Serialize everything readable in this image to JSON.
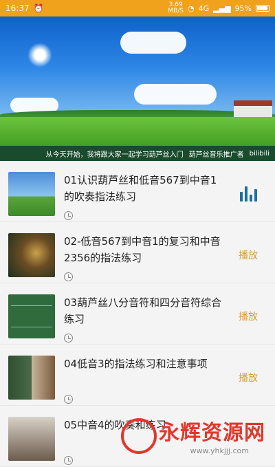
{
  "status": {
    "time": "16:37",
    "speed_value": "3.69",
    "speed_unit": "MB/S",
    "network": "4G",
    "battery": "95%"
  },
  "banner": {
    "caption": "从今天开始，我将跟大家一起学习葫芦丝入门",
    "caption_right": "葫芦丝音乐推广者",
    "brand": "bilibili"
  },
  "list": {
    "items": [
      {
        "title": "01认识葫芦丝和低音567到中音1的吹奏指法练习",
        "action": "playing"
      },
      {
        "title": "02-低音567到中音1的复习和中音2356的指法练习",
        "action": "播放"
      },
      {
        "title": "03葫芦丝八分音符和四分音符综合练习",
        "action": "播放"
      },
      {
        "title": "04低音3的指法练习和注意事项",
        "action": "播放"
      },
      {
        "title": "05中音4的吹奏和练习",
        "action": ""
      }
    ]
  },
  "watermark": {
    "text": "永辉资源网",
    "url": "www.yhkjjj.com"
  }
}
